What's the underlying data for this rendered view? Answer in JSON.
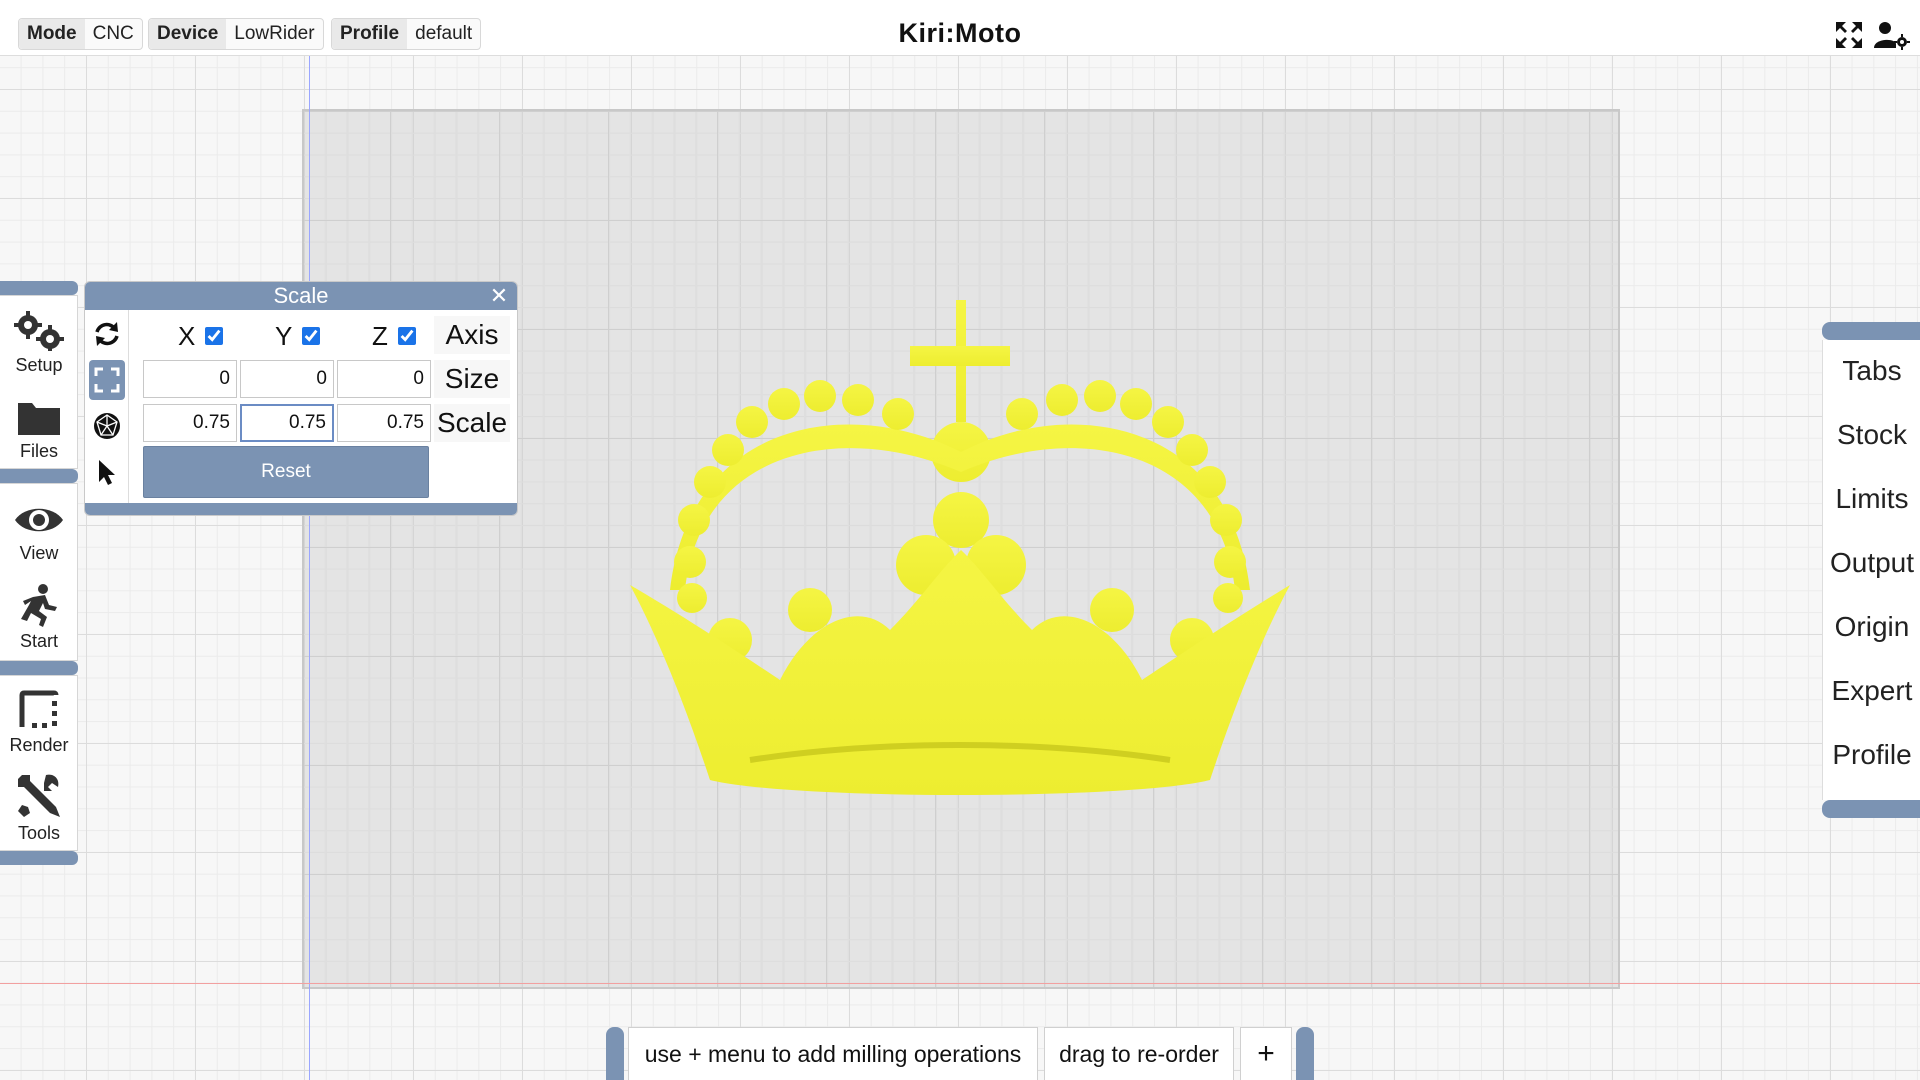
{
  "topbar": {
    "mode": {
      "key": "Mode",
      "value": "CNC"
    },
    "device": {
      "key": "Device",
      "value": "LowRider"
    },
    "profile": {
      "key": "Profile",
      "value": "default"
    },
    "title": "Kiri:Moto",
    "icons": [
      "fullscreen-icon",
      "user-settings-icon"
    ]
  },
  "left_toolbar": [
    {
      "label": "Setup",
      "icon": "gears-icon"
    },
    {
      "label": "Files",
      "icon": "folder-icon"
    },
    {
      "label": "View",
      "icon": "eye-icon"
    },
    {
      "label": "Start",
      "icon": "running-person-icon"
    },
    {
      "label": "Render",
      "icon": "render-frame-icon"
    },
    {
      "label": "Tools",
      "icon": "tools-icon"
    }
  ],
  "scale_dialog": {
    "title": "Scale",
    "axes": [
      {
        "label": "X",
        "checked": true
      },
      {
        "label": "Y",
        "checked": true
      },
      {
        "label": "Z",
        "checked": true
      }
    ],
    "axis_label": "Axis",
    "size_label": "Size",
    "scale_label": "Scale",
    "size_values": [
      "0",
      "0",
      "0"
    ],
    "scale_values": [
      "0.75",
      "0.75",
      "0.75"
    ],
    "reset_label": "Reset",
    "side_tools": [
      "rotate-icon",
      "scale-icon",
      "mesh-icon",
      "select-arrow-icon"
    ],
    "active_tool": "scale-icon"
  },
  "right_menu": [
    "Tabs",
    "Stock",
    "Limits",
    "Output",
    "Origin",
    "Expert",
    "Profile"
  ],
  "ops_bar": {
    "hint": "use + menu to add milling operations",
    "reorder": "drag to re-order",
    "add": "+"
  },
  "colors": {
    "accent": "#7b93b3",
    "model": "#f2f23a",
    "bed": "#d2d2d2"
  }
}
